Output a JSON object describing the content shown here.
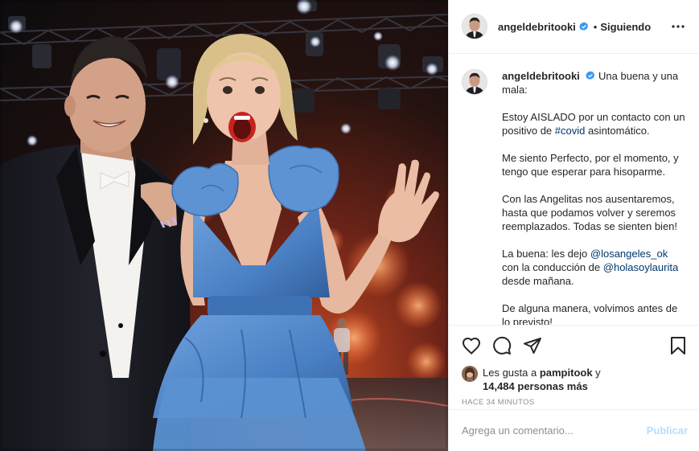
{
  "header": {
    "username": "angeldebritooki",
    "verified_icon": "verified-badge-icon",
    "separator": "•",
    "follow_status": "Siguiendo",
    "more_icon": "more-options-icon"
  },
  "caption": {
    "username": "angeldebritooki",
    "first_line": "Una buena y una mala:",
    "p1_before": "Estoy AISLADO por un contacto con un positivo de ",
    "p1_tag": "#covid",
    "p1_after": " asintomático.",
    "p2": "Me siento Perfecto, por el momento, y tengo que esperar para hisoparme.",
    "p3": "Con las Angelitas nos ausentaremos, hasta que podamos volver y seremos reemplazados. Todas se sienten bien!",
    "p4_a": "La buena: les dejo ",
    "p4_mention1": "@losangeles_ok",
    "p4_b": " con la conducción de ",
    "p4_mention2": "@holasoylaurita",
    "p4_c": " desde mañana.",
    "p5": "De alguna manera, volvimos antes de lo previsto!"
  },
  "actions": {
    "like_icon": "heart-icon",
    "comment_icon": "comment-icon",
    "share_icon": "share-icon",
    "save_icon": "bookmark-icon"
  },
  "likes": {
    "prefix": "Les gusta a ",
    "user": "pampitook",
    "connector": " y",
    "count": "14,484 personas más"
  },
  "timestamp": "HACE 34 MINUTOS",
  "comment_box": {
    "placeholder": "Agrega un comentario...",
    "publish_label": "Publicar"
  },
  "colors": {
    "verified": "#3897f0",
    "link": "#00376b",
    "publish_disabled": "#b2dffc",
    "muted": "#8e8e8e",
    "dress": "#4f86c9"
  }
}
